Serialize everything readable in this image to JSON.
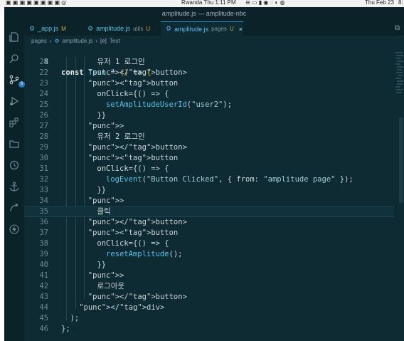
{
  "menubar": {
    "items": [
      "Rwanda Thu 1:11 PM",
      "Thu Feb 23",
      "8:"
    ]
  },
  "window": {
    "title": "amplitude.js — amplitude-nbc"
  },
  "activity_bar": [
    {
      "name": "explorer-icon"
    },
    {
      "name": "search-icon"
    },
    {
      "name": "source-control-icon",
      "badge": "6"
    },
    {
      "name": "run-debug-icon"
    },
    {
      "name": "extensions-icon"
    },
    {
      "name": "folder-icon"
    },
    {
      "name": "timeline-icon"
    },
    {
      "name": "anchor-icon"
    },
    {
      "name": "remote-icon"
    },
    {
      "name": "lightning-icon"
    }
  ],
  "tabs": [
    {
      "name": "_app.js",
      "dir": "",
      "status": "M",
      "active": false
    },
    {
      "name": "amplitude.js",
      "dir": "utils",
      "status": "U",
      "active": false
    },
    {
      "name": "amplitude.js",
      "dir": "pages",
      "status": "U",
      "active": true,
      "close": "×"
    }
  ],
  "breadcrumb": [
    "pages",
    "amplitude.js",
    "Test"
  ],
  "editor": {
    "sticky": {
      "n": "8",
      "code": "const Test = () => {"
    },
    "lines": [
      {
        "n": "21",
        "code": "유저 1 로그인"
      },
      {
        "n": "22",
        "code": "</button>"
      },
      {
        "n": "23",
        "code": "<button"
      },
      {
        "n": "24",
        "code": "onClick={() => {"
      },
      {
        "n": "25",
        "code": "setAmplitudeUserId(\"user2\");"
      },
      {
        "n": "26",
        "code": "}}"
      },
      {
        "n": "27",
        "code": ">"
      },
      {
        "n": "28",
        "code": "유저 2 로그인"
      },
      {
        "n": "29",
        "code": "</button>"
      },
      {
        "n": "30",
        "code": "<button"
      },
      {
        "n": "31",
        "code": "onClick={() => {"
      },
      {
        "n": "32",
        "code": "logEvent(\"Button Clicked\", { from: \"amplitude page\" });"
      },
      {
        "n": "33",
        "code": "}}"
      },
      {
        "n": "34",
        "code": ">"
      },
      {
        "n": "35",
        "code": "클릭"
      },
      {
        "n": "36",
        "code": "</button>"
      },
      {
        "n": "37",
        "code": "<button"
      },
      {
        "n": "38",
        "code": "onClick={() => {"
      },
      {
        "n": "39",
        "code": "resetAmplitude();"
      },
      {
        "n": "40",
        "code": "}}"
      },
      {
        "n": "41",
        "code": ">"
      },
      {
        "n": "42",
        "code": "로그아웃"
      },
      {
        "n": "43",
        "code": "</button>"
      },
      {
        "n": "44",
        "code": "</div>"
      },
      {
        "n": "45",
        "code": ");"
      },
      {
        "n": "46",
        "code": "};"
      }
    ]
  },
  "colors": {
    "background": "#0e2a33",
    "tag": "#2d8fd5",
    "function": "#59c1e8",
    "bracket": "#d2b24a"
  }
}
